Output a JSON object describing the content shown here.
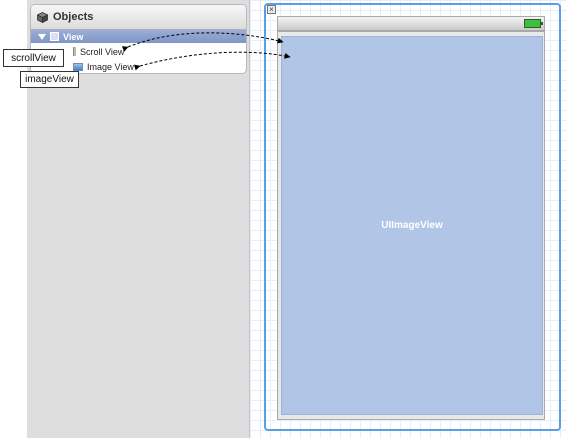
{
  "objects_panel": {
    "title": "Objects",
    "tree": {
      "view": "View",
      "scroll_view": "Scroll View",
      "image_view": "Image View"
    }
  },
  "callouts": {
    "scroll": "scrollView",
    "image": "imageView"
  },
  "canvas": {
    "image_view_label": "UIImageView"
  },
  "colors": {
    "selection": "#8aa0cf",
    "image_view_fill": "#b1c6e6",
    "frame_border": "#5b9ee6"
  }
}
